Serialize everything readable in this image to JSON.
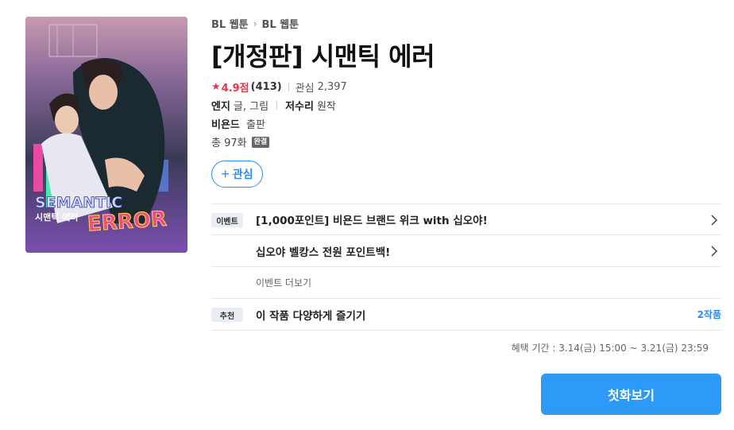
{
  "cover": {
    "alt_title": "SEMANTIC ERROR",
    "alt_sub": "시맨틱 에러"
  },
  "breadcrumb": {
    "first": "BL 웹툰",
    "second": "BL 웹툰"
  },
  "title": "[개정판] 시맨틱 에러",
  "rating": {
    "score": "4.9점",
    "count": "(413)",
    "fav_label": "관심",
    "fav_count": "2,397"
  },
  "authors": {
    "author1_name": "엔지",
    "author1_role": "글, 그림",
    "author2_name": "저수리",
    "author2_role": "원작"
  },
  "publisher": {
    "name": "비욘드",
    "role": "출판"
  },
  "episodes": {
    "text": "총 97화",
    "status_badge": "완결"
  },
  "fav_button": {
    "label": "관심"
  },
  "events": {
    "tag": "이벤트",
    "items": [
      "[1,000포인트] 비욘드 브랜드 위크 with 십오야!",
      "십오야 벨캉스 전원 포인트백!"
    ],
    "more_label": "이벤트 더보기"
  },
  "recommend": {
    "tag": "추천",
    "text": "이 작품 다양하게 즐기기",
    "count": "2작품"
  },
  "period": "혜택 기간 : 3.14(금) 15:00 ~ 3.21(금) 23:59",
  "first_episode_button": "첫화보기",
  "colors": {
    "accent": "#2e9af8",
    "rating": "#e8354a"
  }
}
